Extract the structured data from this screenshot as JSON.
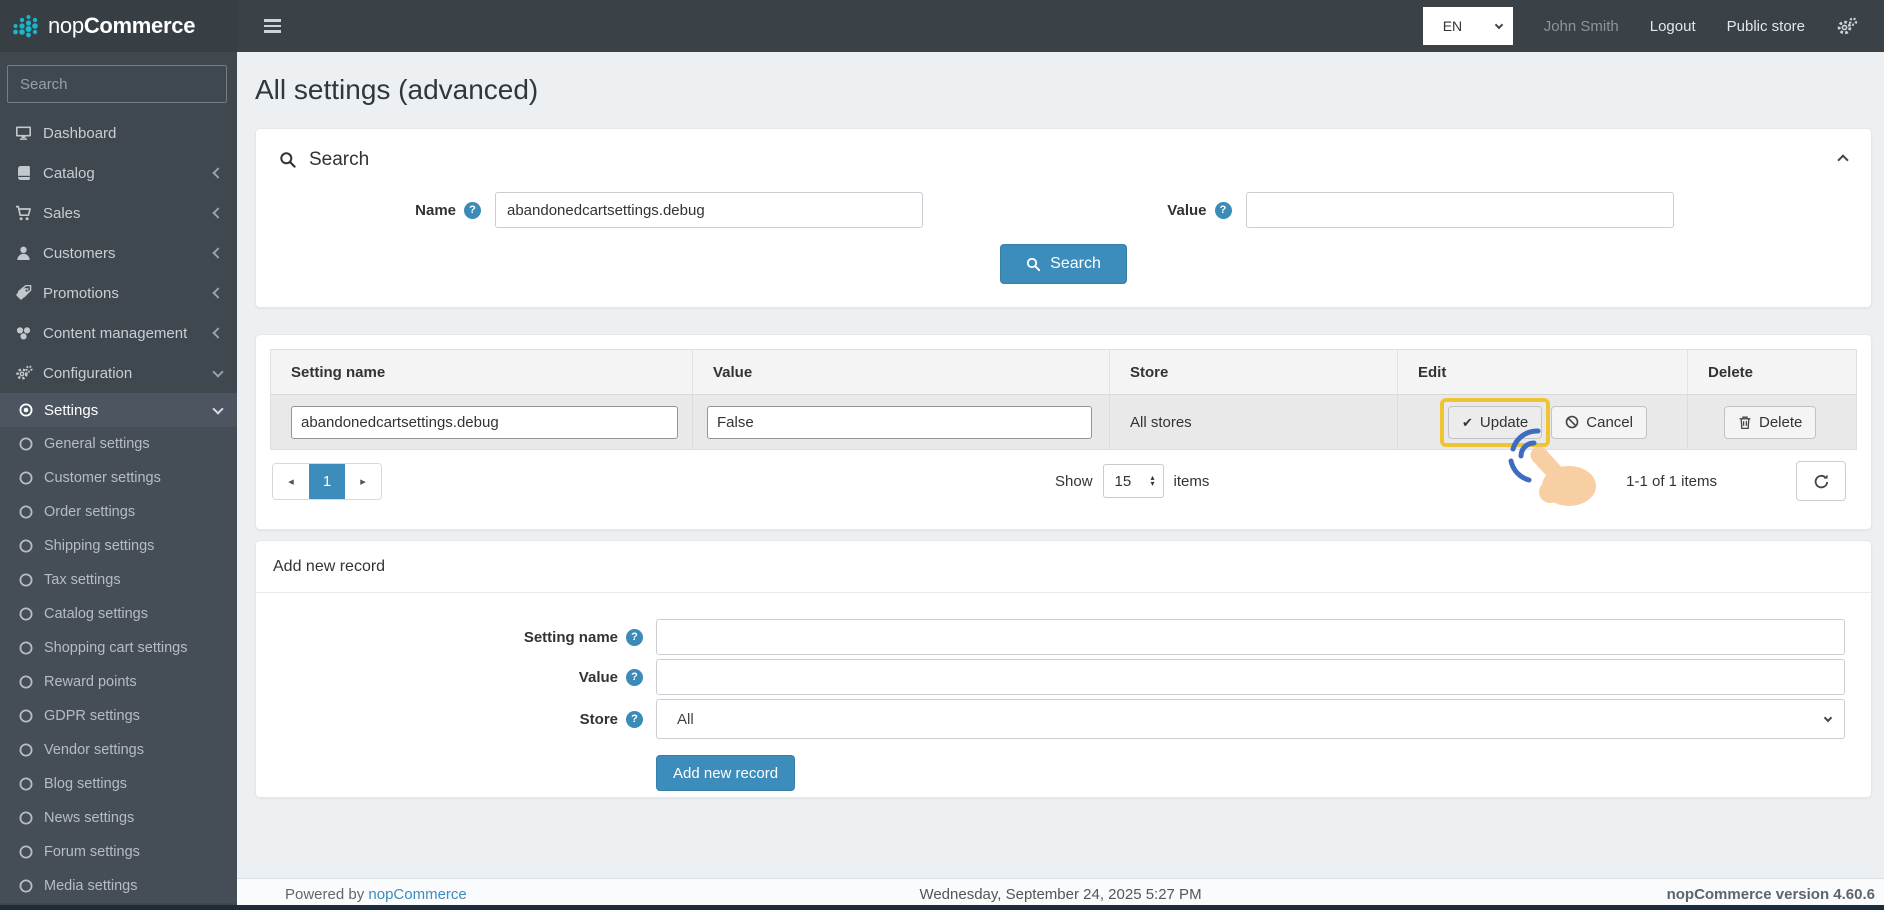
{
  "header": {
    "brand_prefix": "nop",
    "brand_suffix": "Commerce",
    "language_selected": "EN",
    "user_name": "John Smith",
    "logout": "Logout",
    "public_store": "Public store"
  },
  "sidebar": {
    "search_placeholder": "Search",
    "items": [
      "Dashboard",
      "Catalog",
      "Sales",
      "Customers",
      "Promotions",
      "Content management",
      "Configuration"
    ],
    "settings": "Settings",
    "sub_items": [
      "General settings",
      "Customer settings",
      "Order settings",
      "Shipping settings",
      "Tax settings",
      "Catalog settings",
      "Shopping cart settings",
      "Reward points",
      "GDPR settings",
      "Vendor settings",
      "Blog settings",
      "News settings",
      "Forum settings",
      "Media settings"
    ]
  },
  "page_title": "All settings (advanced)",
  "search_panel": {
    "title": "Search",
    "name_label": "Name",
    "name_value": "abandonedcartsettings.debug",
    "value_label": "Value",
    "value_value": "",
    "button": "Search"
  },
  "table": {
    "columns": {
      "setting_name": "Setting name",
      "value": "Value",
      "store": "Store",
      "edit": "Edit",
      "delete": "Delete"
    },
    "row": {
      "setting_name": "abandonedcartsettings.debug",
      "value": "False",
      "store": "All stores",
      "update": "Update",
      "cancel": "Cancel",
      "delete": "Delete"
    },
    "pager": {
      "page": "1",
      "show": "Show",
      "page_size": "15",
      "items": "items",
      "range": "1-1 of 1 items"
    }
  },
  "add_record": {
    "title": "Add new record",
    "setting_name_label": "Setting name",
    "value_label": "Value",
    "store_label": "Store",
    "store_selected": "All",
    "submit": "Add new record"
  },
  "footer": {
    "powered_by": "Powered by",
    "link": "nopCommerce",
    "datetime": "Wednesday, September 24, 2025 5:27 PM",
    "version": "nopCommerce version 4.60.6"
  },
  "colors": {
    "accent": "#3c8dbc",
    "header_bg": "#3a4147",
    "sidebar_bg": "#3f474f",
    "logo_dots": "#19b6ca",
    "click_highlight": "#f0c331",
    "hand_fill": "#f8cfa2",
    "click_ripple": "#3f6cc0"
  }
}
